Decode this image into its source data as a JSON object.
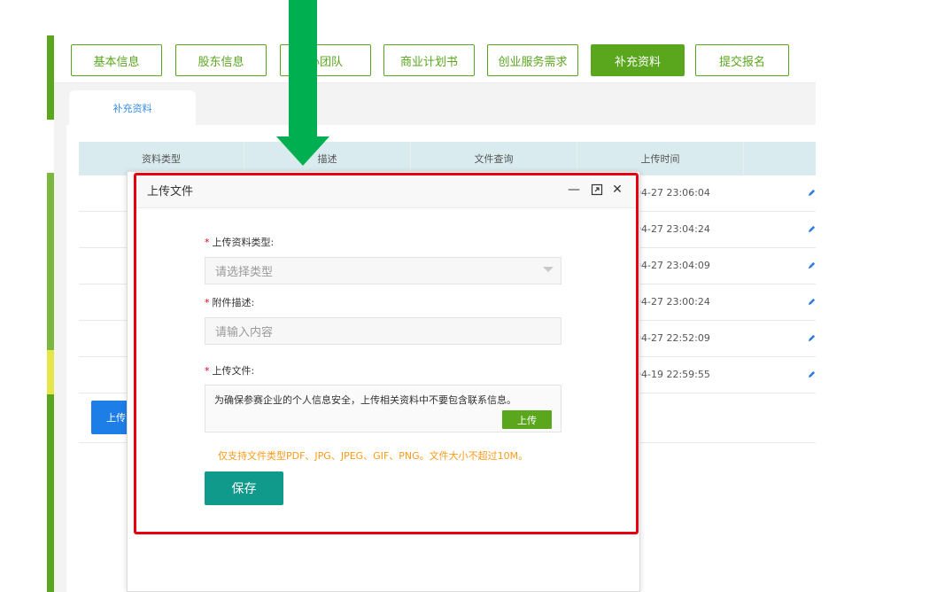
{
  "tabs": [
    {
      "label": "基本信息",
      "active": false
    },
    {
      "label": "股东信息",
      "active": false
    },
    {
      "label": "心团队",
      "active": false
    },
    {
      "label": "商业计划书",
      "active": false
    },
    {
      "label": "创业服务需求",
      "active": false
    },
    {
      "label": "补充资料",
      "active": true
    },
    {
      "label": "提交报名",
      "active": false
    }
  ],
  "subtab": {
    "label": "补充资料"
  },
  "table": {
    "headers": [
      "资料类型",
      "描述",
      "文件查询",
      "上传时间"
    ],
    "rows": [
      {
        "upload_time": "04-27 23:06:04"
      },
      {
        "upload_time": "04-27 23:04:24"
      },
      {
        "upload_time": "04-27 23:04:09"
      },
      {
        "upload_time": "04-27 23:00:24"
      },
      {
        "upload_time": "04-27 22:52:09"
      },
      {
        "upload_time": "04-19 22:59:55"
      }
    ]
  },
  "upload_button_label": "上传",
  "dialog": {
    "title": "上传文件",
    "minimize_glyph": "—",
    "maximize_glyph": "⤢",
    "close_glyph": "✕",
    "type_label": "上传资料类型:",
    "type_placeholder": "请选择类型",
    "desc_label": "附件描述:",
    "desc_placeholder": "请输入内容",
    "file_label": "上传文件:",
    "file_hint": "为确保参赛企业的个人信息安全，上传相关资料中不要包含联系信息。",
    "file_upload_label": "上传",
    "note": "仅支持文件类型PDF、JPG、JPEG、GIF、PNG。文件大小不超过10M。",
    "save_label": "保存",
    "required_mark": "*"
  },
  "colors": {
    "brand_green": "#5aa61d",
    "arrow_green": "#00b050",
    "highlight_red": "#e60012",
    "save_teal": "#0f9a8c",
    "note_orange": "#ff9a1a",
    "upload_blue": "#1e7ee8"
  }
}
